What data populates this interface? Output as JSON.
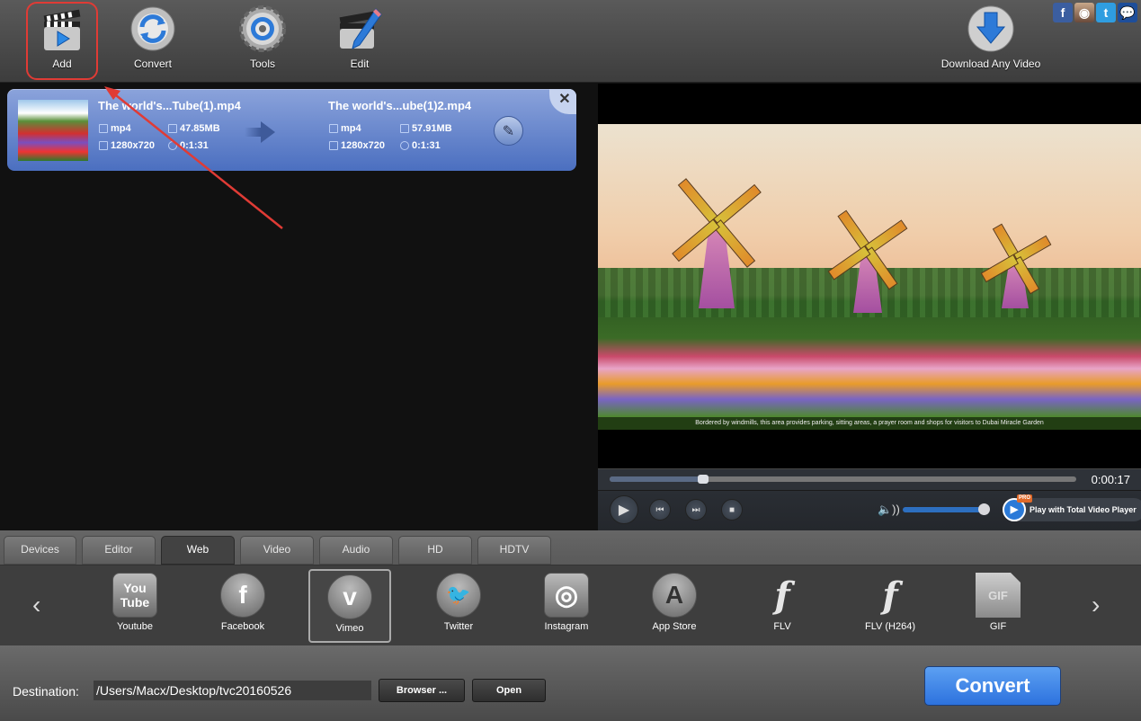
{
  "toolbar": {
    "add_label": "Add",
    "convert_label": "Convert",
    "tools_label": "Tools",
    "edit_label": "Edit",
    "download_label": "Download Any Video",
    "social": [
      {
        "name": "facebook",
        "glyph": "f"
      },
      {
        "name": "instagram",
        "glyph": "◉"
      },
      {
        "name": "twitter",
        "glyph": "t"
      },
      {
        "name": "chat",
        "glyph": "💬"
      }
    ]
  },
  "file_list": {
    "items": [
      {
        "source": {
          "name": "The world's...Tube(1).mp4",
          "format": "mp4",
          "size": "47.85MB",
          "resolution": "1280x720",
          "duration": "0:1:31"
        },
        "output": {
          "name": "The world's...ube(1)2.mp4",
          "format": "mp4",
          "size": "57.91MB",
          "resolution": "1280x720",
          "duration": "0:1:31"
        }
      }
    ]
  },
  "player": {
    "caption": "Bordered by windmills, this area provides parking, sitting areas, a prayer room and shops for visitors to Dubai Miracle Garden",
    "time": "0:00:17",
    "progress_fraction": 0.2,
    "volume_fraction": 0.98,
    "tvp_badge": "PRO",
    "tvp_label": "Play with Total Video Player",
    "play_glyph": "▶",
    "prev_glyph": "⏮",
    "next_glyph": "⏭",
    "stop_glyph": "■",
    "volume_glyph": "🔈))"
  },
  "tabs": [
    {
      "label": "Devices",
      "active": false
    },
    {
      "label": "Editor",
      "active": false
    },
    {
      "label": "Web",
      "active": true
    },
    {
      "label": "Video",
      "active": false
    },
    {
      "label": "Audio",
      "active": false
    },
    {
      "label": "HD",
      "active": false
    },
    {
      "label": "HDTV",
      "active": false
    }
  ],
  "profiles": {
    "prev_glyph": "‹",
    "next_glyph": "›",
    "items": [
      {
        "label": "Youtube",
        "glyph": "You Tube",
        "selected": false
      },
      {
        "label": "Facebook",
        "glyph": "f",
        "selected": false
      },
      {
        "label": "Vimeo",
        "glyph": "v",
        "selected": true
      },
      {
        "label": "Twitter",
        "glyph": "🐦",
        "selected": false
      },
      {
        "label": "Instagram",
        "glyph": "◎",
        "selected": false
      },
      {
        "label": "App Store",
        "glyph": "A",
        "selected": false
      },
      {
        "label": "FLV",
        "glyph": "f",
        "selected": false
      },
      {
        "label": "FLV (H264)",
        "glyph": "f",
        "selected": false
      },
      {
        "label": "GIF",
        "glyph": "GIF",
        "selected": false
      }
    ]
  },
  "destination": {
    "label": "Destination:",
    "path": "/Users/Macx/Desktop/tvc20160526",
    "browser_label": "Browser ...",
    "open_label": "Open"
  },
  "convert_button_label": "Convert"
}
